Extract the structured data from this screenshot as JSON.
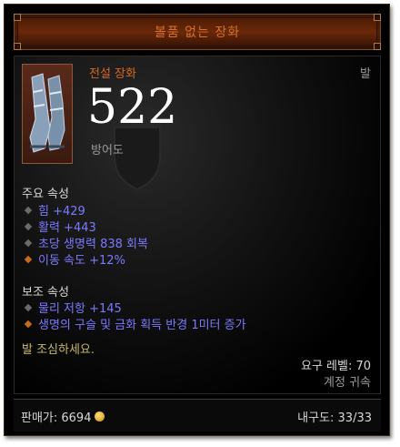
{
  "item": {
    "name": "볼품 없는 장화",
    "rarity": "전설 장화",
    "slot": "발",
    "armor": "522",
    "armor_label": "방어도"
  },
  "primary": {
    "title": "주요 속성",
    "stats": [
      {
        "text": "힘 +429",
        "bullet": "grey"
      },
      {
        "text": "활력 +443",
        "bullet": "grey"
      },
      {
        "text": "초당 생명력 838 회복",
        "bullet": "grey"
      },
      {
        "text": "이동 속도 +12%",
        "bullet": "orange"
      }
    ]
  },
  "secondary": {
    "title": "보조 속성",
    "stats": [
      {
        "text": "물리 저항 +145",
        "bullet": "grey"
      },
      {
        "text": "생명의 구슬 및 금화 획득 반경 1미터 증가",
        "bullet": "orange"
      }
    ]
  },
  "flavor": "발 조심하세요.",
  "requirement": "요구 레벨: 70",
  "binding": "계정 귀속",
  "footer": {
    "price": "판매가: 6694",
    "durability": "내구도: 33/33"
  },
  "colors": {
    "legendary": "#d66a22",
    "stat": "#7a7aff",
    "flavor": "#c8b860"
  }
}
